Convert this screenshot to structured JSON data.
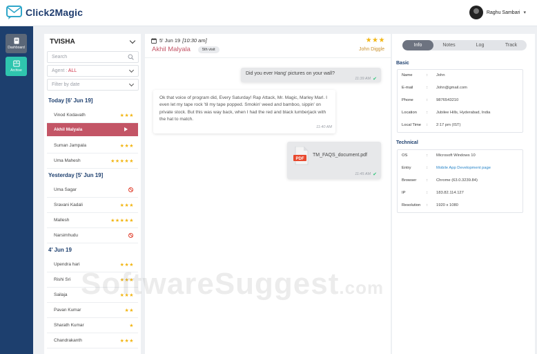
{
  "app": {
    "logo_text": "Click2Magic"
  },
  "user": {
    "name": "Raghu Sambari"
  },
  "nav": {
    "dashboard_label": "Dashboard",
    "archive_label": "Archive"
  },
  "list": {
    "title": "TVISHA",
    "search_placeholder": "Search",
    "agent_label": "Agent : ",
    "agent_value": "ALL",
    "date_filter_label": "Filter by date",
    "groups": [
      {
        "title": "Today",
        "date": "[6' Jun 19]",
        "visitors": [
          {
            "name": "Vinod Kodavath",
            "stars": "★★★"
          },
          {
            "name": "Akhil Malyala",
            "active": true
          },
          {
            "name": "Suman Jampala",
            "stars": "★★★"
          },
          {
            "name": "Uma Mahesh",
            "stars": "★★★★★"
          }
        ]
      },
      {
        "title": "Yesterday",
        "date": "[5' Jun 19]",
        "visitors": [
          {
            "name": "Uma Sagar",
            "blocked": true
          },
          {
            "name": "Sravani Kadali",
            "stars": "★★★"
          },
          {
            "name": "Mallesh",
            "stars": "★★★★★"
          },
          {
            "name": "Narsimhudu",
            "blocked": true
          }
        ]
      },
      {
        "title": "4' Jun 19",
        "date": "",
        "visitors": [
          {
            "name": "Upendra hari",
            "stars": "★★★"
          },
          {
            "name": "Rishi Sri",
            "stars": "★★★"
          },
          {
            "name": "Sailaja",
            "stars": "★★★"
          },
          {
            "name": "Pavan Kumar",
            "stars": "★★"
          },
          {
            "name": "Sharath Kumar",
            "stars": "★"
          },
          {
            "name": "Chandrakanth",
            "stars": "★★★"
          }
        ]
      }
    ]
  },
  "chat": {
    "date": "5' Jun 19",
    "time": "[10:30 am]",
    "visitor_name": "Akhil Malyala",
    "visit_badge": "5th visit",
    "agent_stars": "★★★",
    "agent_name": "John Diggle",
    "messages": [
      {
        "text": "Did you ever Hang' pictures on your wall?",
        "time": "11:39 AM"
      },
      {
        "text": "Ok that voice of program did, Every Saturday! Rap Attack, Mr. Magic, Marley Marl. I even let my tape rock 'til my tape popped. Smokin' weed and bamboo, sippin' on private stock. But this was way back, when I had the red and black lumberjack with the hat to match.",
        "time": "11:40 AM"
      },
      {
        "file_name": "TM_FAQS_document.pdf",
        "file_type": "PDF",
        "time": "11:45 AM"
      }
    ]
  },
  "info": {
    "tabs": [
      "Info",
      "Notes",
      "Log",
      "Track"
    ],
    "basic_title": "Basic",
    "basic": [
      {
        "key": "Name",
        "value": "John"
      },
      {
        "key": "E-mail",
        "value": "John@gmail.com"
      },
      {
        "key": "Phone",
        "value": "9876543210"
      },
      {
        "key": "Location",
        "value": "Jubilee Hills, Hyderabad, India"
      },
      {
        "key": "Local Time",
        "value": "2:17 pm (IST)"
      }
    ],
    "technical_title": "Technical",
    "technical": [
      {
        "key": "OS",
        "value": "Microsoft Windows 10"
      },
      {
        "key": "Entry",
        "value": "Mobile App Development page"
      },
      {
        "key": "Browser",
        "value": "Chrome (63.0.3239.84)"
      },
      {
        "key": "IP",
        "value": "183.82.114.127"
      },
      {
        "key": "Resolution",
        "value": "1920 x 1080"
      }
    ]
  },
  "watermark": {
    "main": "SoftwareSuggest",
    "suffix": ".com"
  },
  "colors": {
    "nav_bg": "#1d3f6e",
    "active_row": "#c35566",
    "archive": "#2fc5ae",
    "star": "#f2b615"
  }
}
